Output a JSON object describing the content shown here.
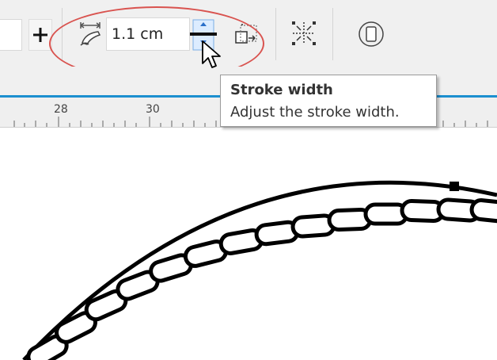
{
  "toolbar": {
    "stroke_width_value": "1.1 cm",
    "icons": [
      "plus-icon",
      "stroke-width-icon",
      "spin-up-icon",
      "spin-down-icon",
      "scale-stroke-icon",
      "center-nodes-icon",
      "rounded-rect-icon"
    ]
  },
  "ruler": {
    "labels": [
      "28",
      "30"
    ]
  },
  "tooltip": {
    "title": "Stroke width",
    "description": "Adjust the stroke width."
  },
  "colors": {
    "accent": "#1c8fcf",
    "highlight": "#d9534f"
  }
}
